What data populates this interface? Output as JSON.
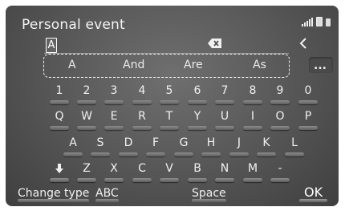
{
  "header": {
    "title": "Personal event"
  },
  "input": {
    "current_text": "A"
  },
  "suggestions": [
    "A",
    "And",
    "Are",
    "As"
  ],
  "more_label": "...",
  "keys": {
    "row1": [
      "1",
      "2",
      "3",
      "4",
      "5",
      "6",
      "7",
      "8",
      "9",
      "0"
    ],
    "row2": [
      "Q",
      "W",
      "E",
      "R",
      "T",
      "Y",
      "U",
      "I",
      "O",
      "P"
    ],
    "row3": [
      "A",
      "S",
      "D",
      "F",
      "G",
      "H",
      "J",
      "K",
      "L"
    ],
    "row4": [
      "Z",
      "X",
      "C",
      "V",
      "B",
      "N",
      "M",
      "-"
    ],
    "shift_icon": "down-arrow-icon"
  },
  "bottom_bar": {
    "change_type": "Change type",
    "mode": "ABC",
    "space": "Space",
    "ok": "OK"
  },
  "colors": {
    "background": "#5a5a5a",
    "text": "#f2f2f2"
  }
}
